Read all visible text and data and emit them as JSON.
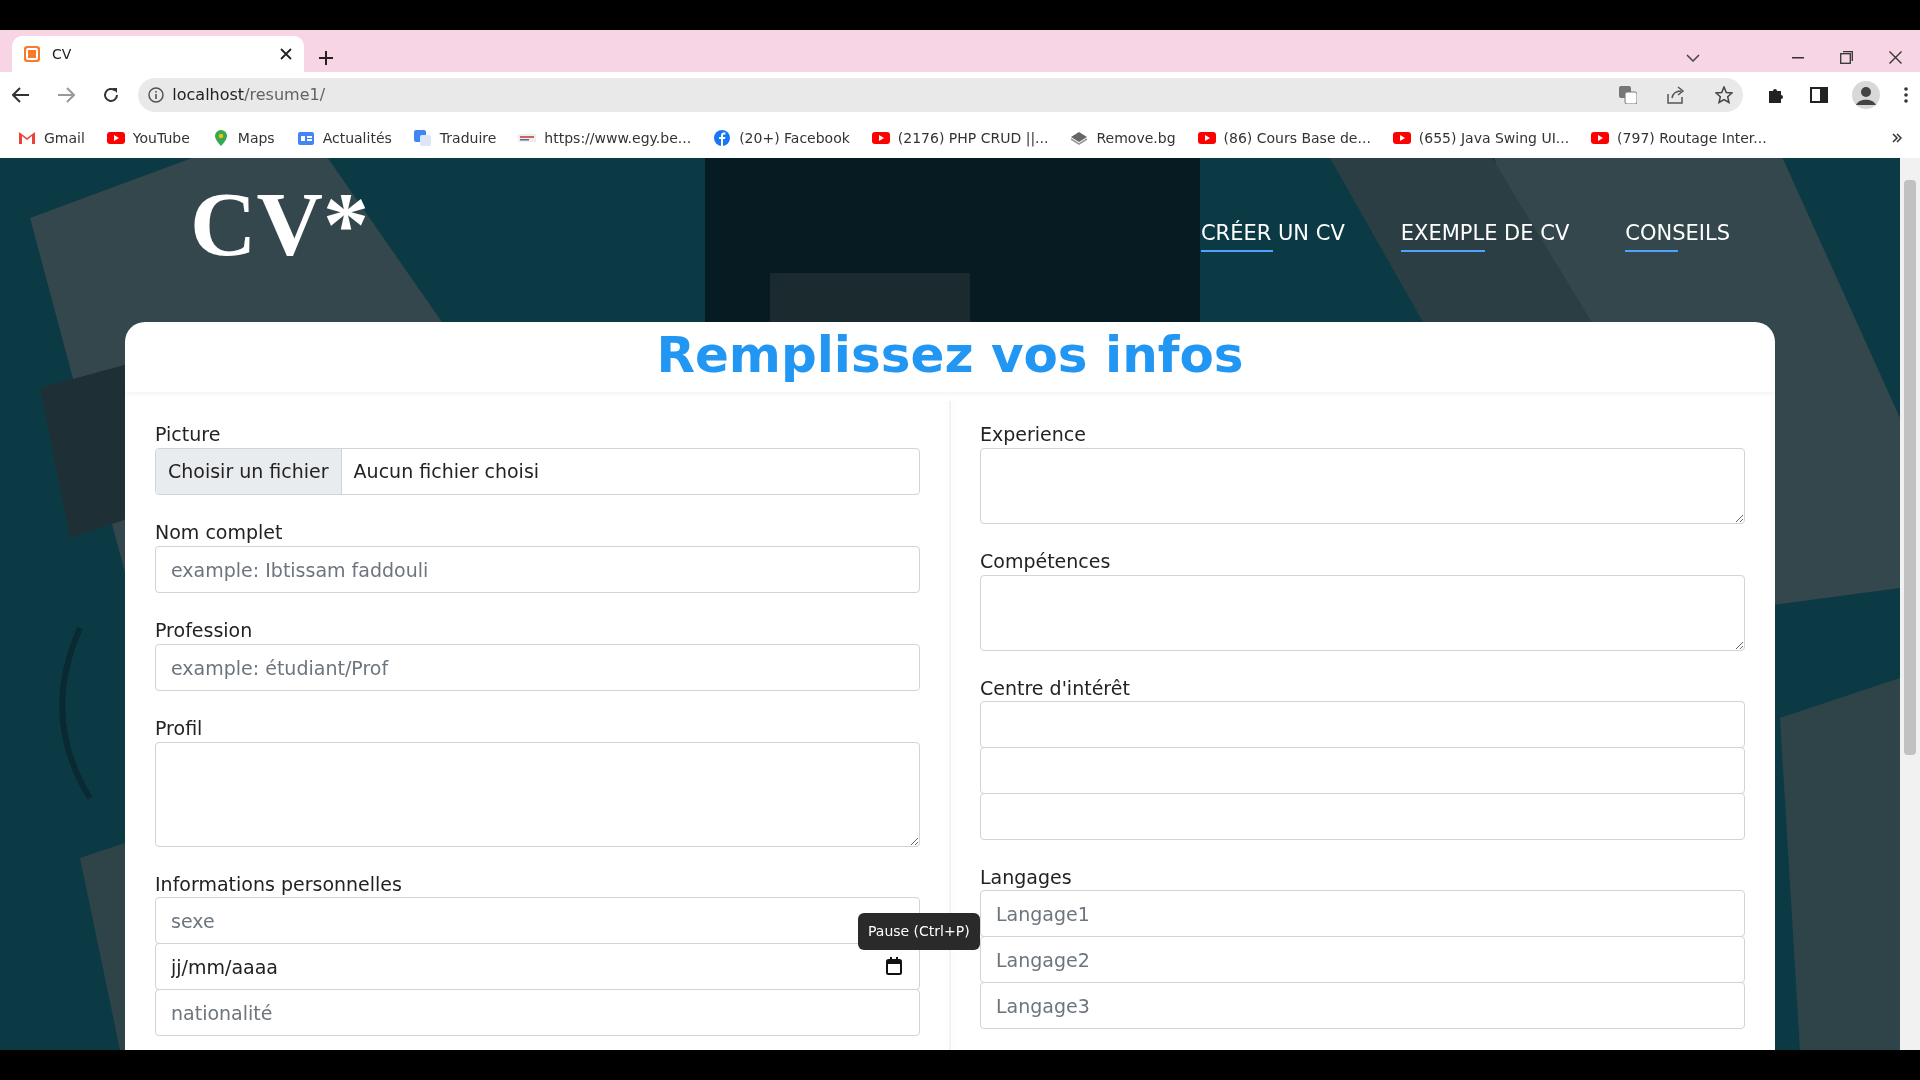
{
  "browser": {
    "tabs": [
      {
        "title": "CV",
        "selected": true
      }
    ],
    "address": {
      "host": "localhost",
      "path": "/resume1/"
    },
    "bookmarks": [
      {
        "label": "Gmail",
        "kind": "mail"
      },
      {
        "label": "YouTube",
        "kind": "video"
      },
      {
        "label": "Maps",
        "kind": "pin"
      },
      {
        "label": "Actualités",
        "kind": "news"
      },
      {
        "label": "Traduire",
        "kind": "translate"
      },
      {
        "label": "https://www.egy.be...",
        "kind": "site"
      },
      {
        "label": "(20+) Facebook",
        "kind": "social"
      },
      {
        "label": "(2176) PHP CRUD ||...",
        "kind": "video"
      },
      {
        "label": "Remove.bg",
        "kind": "layers"
      },
      {
        "label": "(86) Cours Base de...",
        "kind": "video"
      },
      {
        "label": "(655) Java Swing UI...",
        "kind": "video"
      },
      {
        "label": "(797) Routage Inter...",
        "kind": "video"
      }
    ]
  },
  "page": {
    "logo": "CV*",
    "nav": [
      {
        "label": "CRÉER UN CV"
      },
      {
        "label": "EXEMPLE DE CV"
      },
      {
        "label": "CONSEILS"
      }
    ],
    "title": "Remplissez vos infos",
    "left": [
      {
        "kind": "file",
        "label": "Picture",
        "button": "Choisir un fichier",
        "status": "Aucun fichier choisi"
      },
      {
        "kind": "text",
        "label": "Nom complet",
        "placeholder": "example: Ibtissam faddouli"
      },
      {
        "kind": "text",
        "label": "Profession",
        "placeholder": "example: étudiant/Prof"
      },
      {
        "kind": "longtext",
        "label": "Profil"
      },
      {
        "kind": "group",
        "label": "Informations personnelles",
        "inputs": [
          {
            "kind": "text",
            "placeholder": "sexe"
          },
          {
            "kind": "date",
            "value": "jj/mm/aaaa"
          },
          {
            "kind": "text",
            "placeholder": "nationalité"
          }
        ]
      }
    ],
    "right": [
      {
        "kind": "textarea",
        "label": "Experience"
      },
      {
        "kind": "textarea",
        "label": "Compétences"
      },
      {
        "kind": "group",
        "label": "Centre d'intérêt",
        "inputs": [
          {
            "kind": "text"
          },
          {
            "kind": "text"
          },
          {
            "kind": "text"
          }
        ]
      },
      {
        "kind": "group",
        "label": "Langages",
        "inputs": [
          {
            "kind": "text",
            "placeholder": "Langage1"
          },
          {
            "kind": "text",
            "placeholder": "Langage2"
          },
          {
            "kind": "text",
            "placeholder": "Langage3"
          }
        ]
      }
    ]
  },
  "tooltip": {
    "text": "Pause (Ctrl+P)"
  }
}
